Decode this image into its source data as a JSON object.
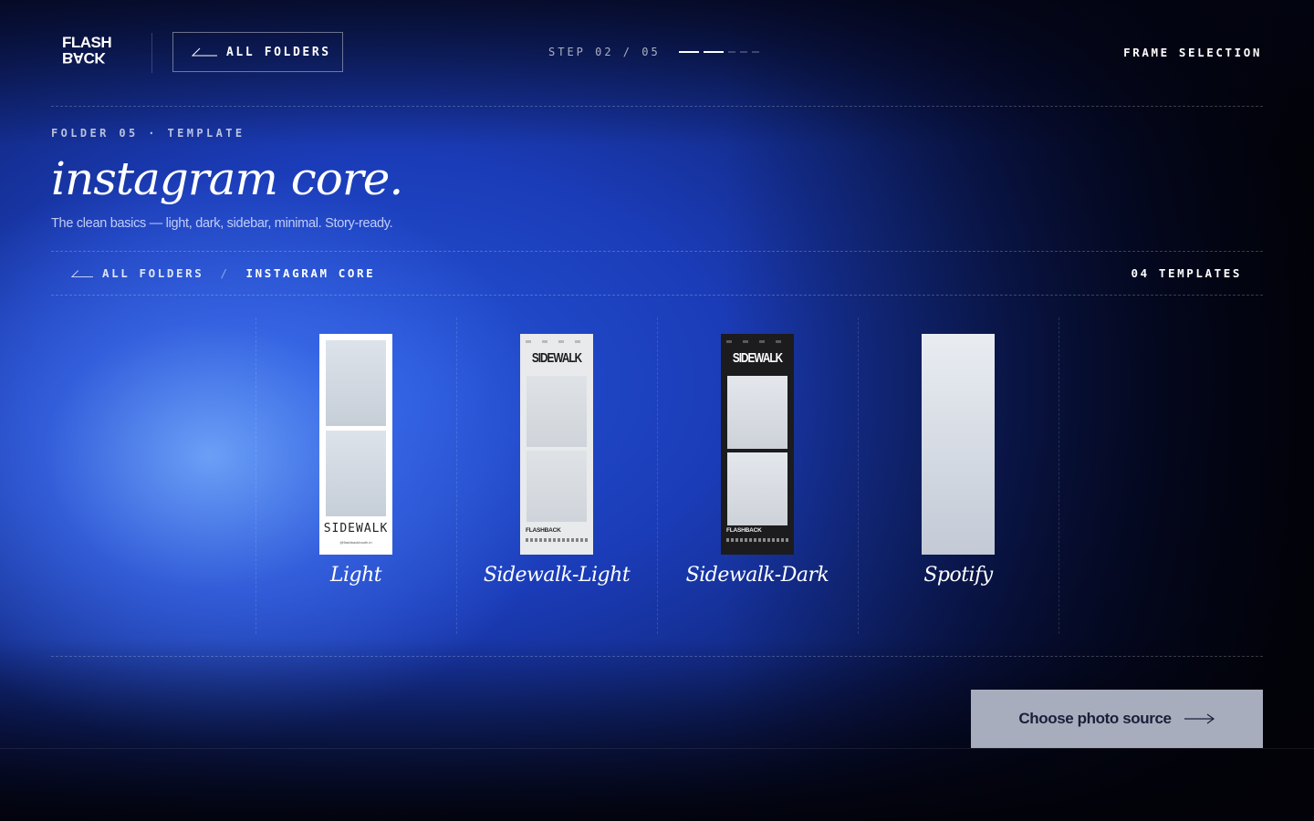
{
  "header": {
    "logo_line1": "FLASH",
    "logo_line2": "BACK",
    "back_button_label": "ALL FOLDERS",
    "step_label": "STEP 02 / 05",
    "step_current": 2,
    "step_total": 5,
    "right_label": "FRAME SELECTION"
  },
  "hero": {
    "eyebrow": "FOLDER 05 · TEMPLATE",
    "title": "instagram core.",
    "subtitle": "The clean basics — light, dark, sidebar, minimal. Story-ready."
  },
  "breadcrumb": {
    "root_label": "ALL FOLDERS",
    "separator": "/",
    "current_label": "INSTAGRAM CORE",
    "count_label": "04 TEMPLATES"
  },
  "templates": [
    {
      "name": "Light",
      "brand_text": "SIDEWALK",
      "handle": "@flashbackbooth.in"
    },
    {
      "name": "Sidewalk-Light",
      "header_text": "SIDEWALK",
      "footer_text": "FLASHBACK"
    },
    {
      "name": "Sidewalk-Dark",
      "header_text": "SIDEWALK",
      "footer_text": "FLASHBACK"
    },
    {
      "name": "Spotify"
    }
  ],
  "cta": {
    "label": "Choose photo source"
  },
  "colors": {
    "background_accent": "#2453d6",
    "cta_background": "#a8adbd",
    "cta_text": "#1a1f3a"
  }
}
